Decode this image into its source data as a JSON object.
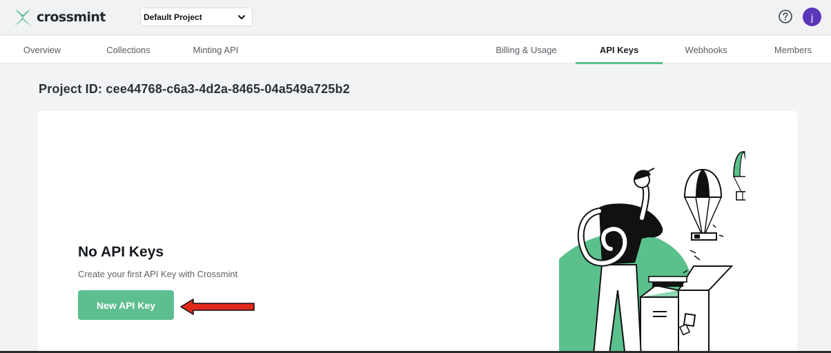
{
  "brand": {
    "name": "crossmint",
    "accent": "#5bc18c",
    "logo_icon": "crossmint-x-logo"
  },
  "project_selector": {
    "value": "Default Project",
    "icon": "chevron-down-icon"
  },
  "header_icons": {
    "help": "question-circle-icon",
    "avatar_initial": "j",
    "avatar_color": "#5b36b8"
  },
  "tabs": [
    {
      "label": "Overview",
      "active": false
    },
    {
      "label": "Collections",
      "active": false
    },
    {
      "label": "Minting API",
      "active": false
    },
    {
      "label": "Billing & Usage",
      "active": false
    },
    {
      "label": "API Keys",
      "active": true
    },
    {
      "label": "Webhooks",
      "active": false
    },
    {
      "label": "Members",
      "active": false
    }
  ],
  "main": {
    "project_id": "Project ID: cee44768-c6a3-4d2a-8465-04a549a725b2",
    "empty_state": {
      "title": "No API Keys",
      "subtitle": "Create your first API Key with Crossmint",
      "button_label": "New API Key",
      "button_color": "#5dbe8f",
      "annotation_icon": "red-arrow-icon",
      "annotation_color": "#e02a1c"
    },
    "illustration_icon": "person-with-parachute-box-illustration"
  }
}
